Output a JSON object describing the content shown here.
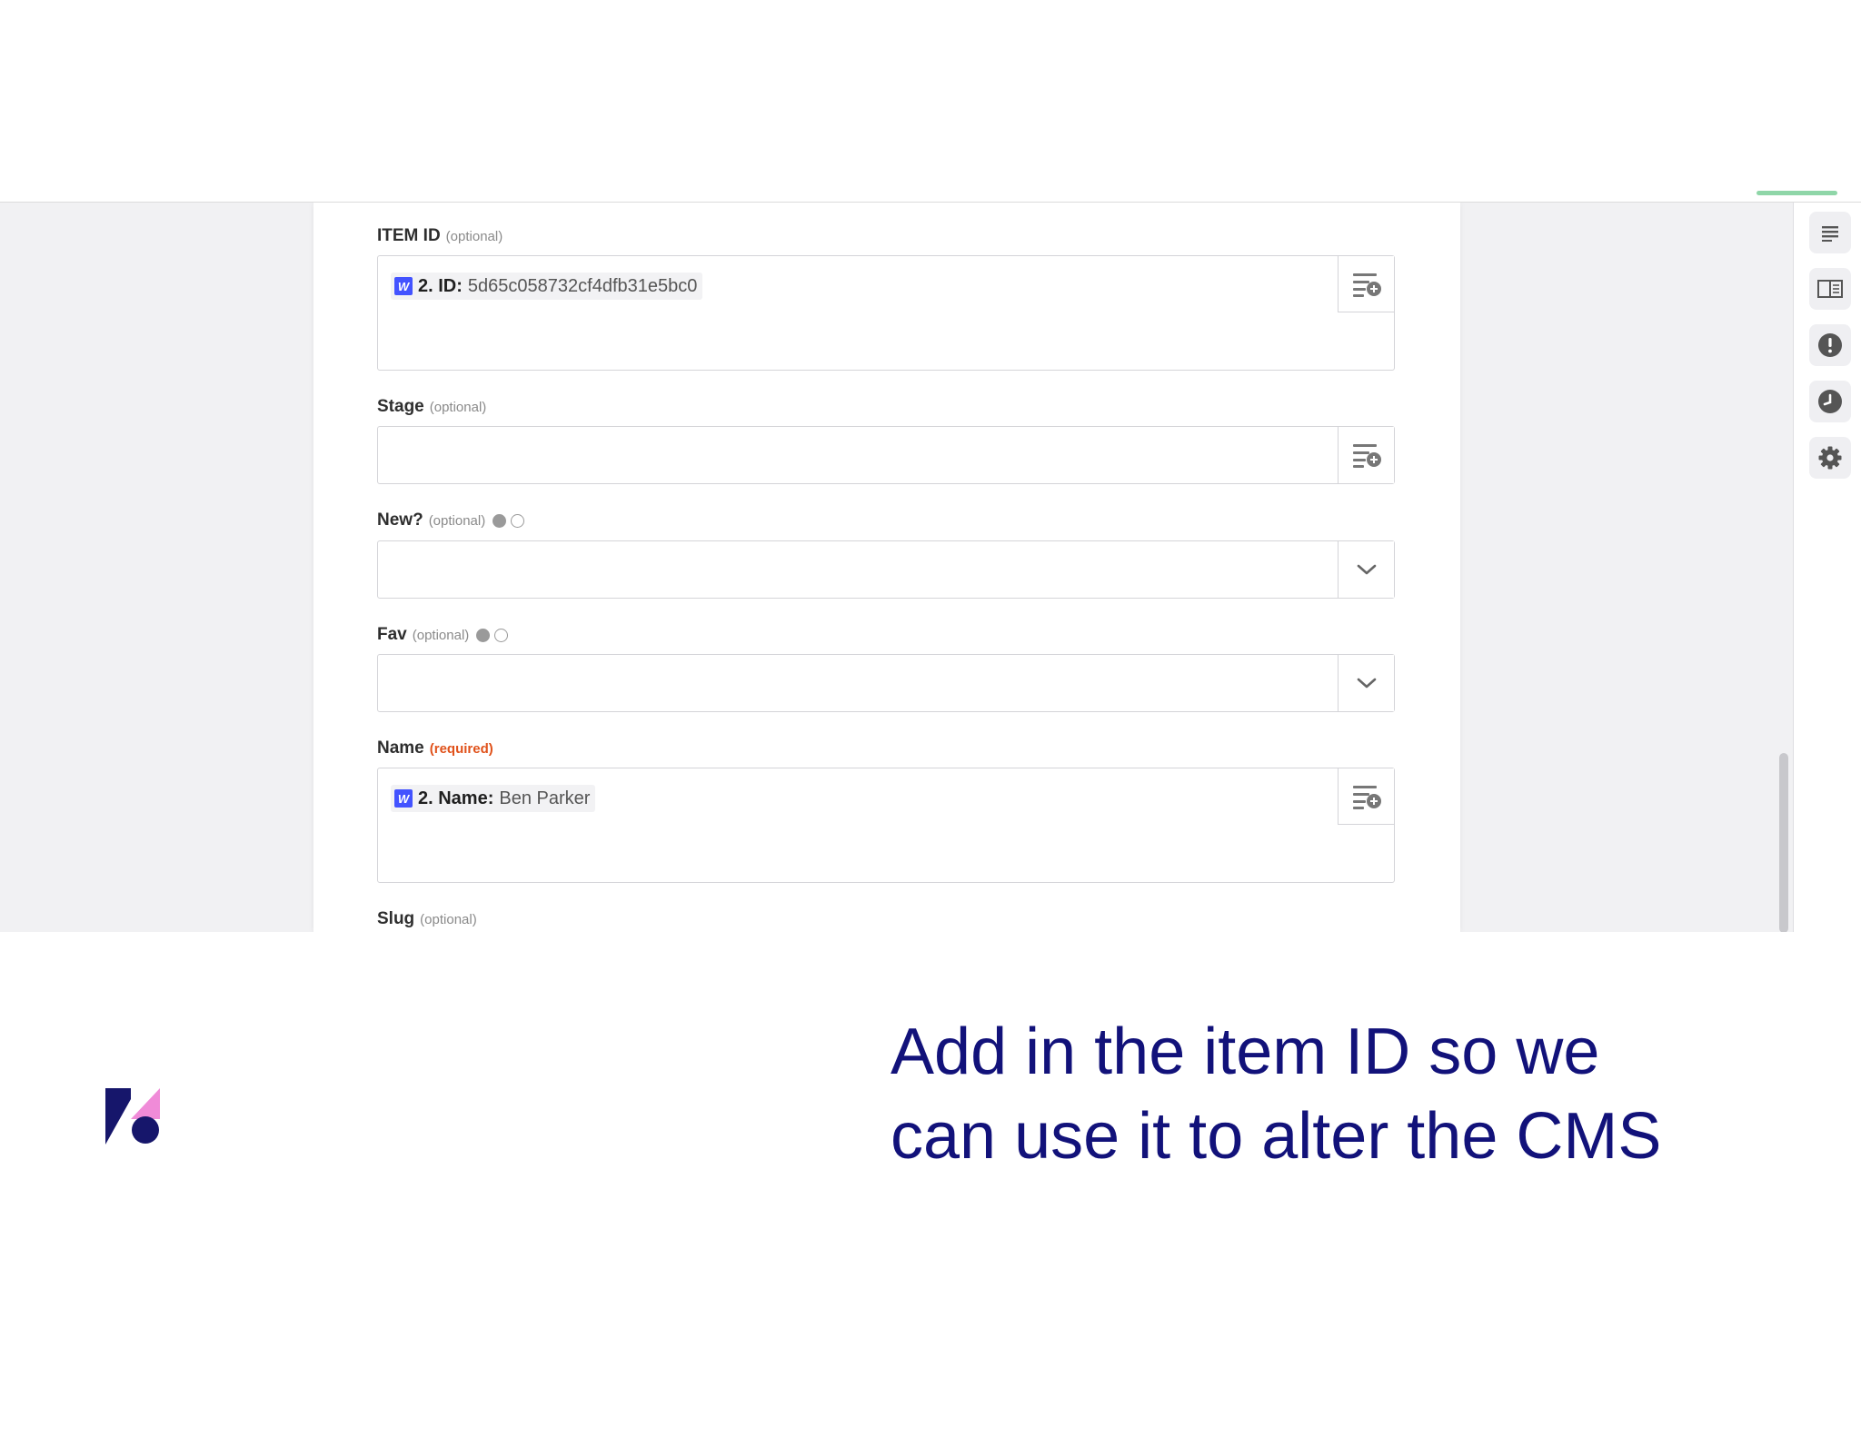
{
  "form": {
    "item_id": {
      "label": "ITEM ID",
      "qualifier": "(optional)",
      "pill": {
        "badge": "W",
        "key": "2. ID:",
        "value": "5d65c058732cf4dfb31e5bc0"
      }
    },
    "stage": {
      "label": "Stage",
      "qualifier": "(optional)"
    },
    "new": {
      "label": "New?",
      "qualifier": "(optional)"
    },
    "fav": {
      "label": "Fav",
      "qualifier": "(optional)"
    },
    "name": {
      "label": "Name",
      "qualifier": "(required)",
      "pill": {
        "badge": "W",
        "key": "2. Name:",
        "value": "Ben Parker"
      }
    },
    "slug": {
      "label": "Slug",
      "qualifier": "(optional)"
    }
  },
  "toolbar": {
    "icons": [
      "list-icon",
      "book-icon",
      "alert-icon",
      "clock-icon",
      "gear-icon"
    ]
  },
  "caption": {
    "line1": "Add in the item ID so we",
    "line2": "can use it to alter the CMS"
  },
  "colors": {
    "accent_badge": "#4353ff",
    "required": "#e0521b",
    "caption": "#12127a",
    "logo_navy": "#16166b",
    "logo_pink": "#f08bd8"
  }
}
